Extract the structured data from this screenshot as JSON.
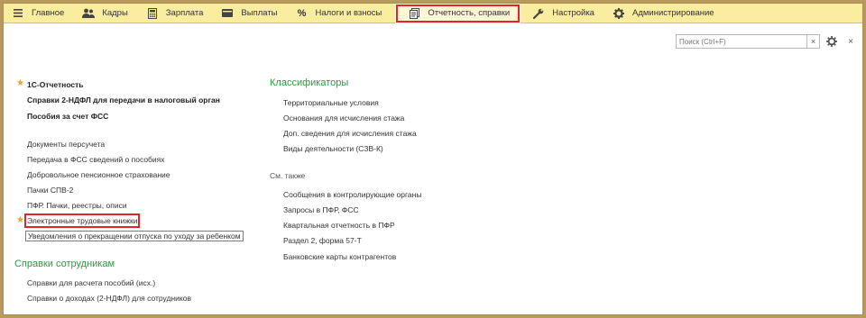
{
  "nav": {
    "items": [
      {
        "label": "Главное",
        "icon": "menu-icon"
      },
      {
        "label": "Кадры",
        "icon": "people-icon"
      },
      {
        "label": "Зарплата",
        "icon": "calculator-icon"
      },
      {
        "label": "Выплаты",
        "icon": "wallet-icon"
      },
      {
        "label": "Налоги и взносы",
        "icon": "percent-icon"
      },
      {
        "label": "Отчетность, справки",
        "icon": "report-icon"
      },
      {
        "label": "Настройка",
        "icon": "wrench-icon"
      },
      {
        "label": "Администрирование",
        "icon": "gear-icon"
      }
    ],
    "active_index": 5
  },
  "search": {
    "placeholder": "Поиск (Ctrl+F)",
    "clear": "×"
  },
  "toolbar": {
    "close": "×"
  },
  "left": {
    "favorites": [
      "1С-Отчетность",
      "Справки 2-НДФЛ для передачи в налоговый орган",
      "Пособия за счет ФСС"
    ],
    "links": [
      "Документы персучета",
      "Передача в ФСС сведений о пособиях",
      "Добровольное пенсионное страхование",
      "Пачки СПВ-2",
      "ПФР. Пачки, реестры, описи",
      "Электронные трудовые книжки",
      "Уведомления о прекращении отпуска по уходу за ребенком"
    ],
    "employees_title": "Справки сотрудникам",
    "employees_links": [
      "Справки для расчета пособий (исх.)",
      "Справки о доходах (2-НДФЛ) для сотрудников"
    ]
  },
  "right": {
    "classifiers_title": "Классификаторы",
    "classifiers": [
      "Территориальные условия",
      "Основания для исчисления стажа",
      "Доп. сведения для исчисления стажа",
      "Виды деятельности (СЗВ-К)"
    ],
    "see_also_title": "См. также",
    "see_also": [
      "Сообщения в контролирующие органы",
      "Запросы в ПФР, ФСС",
      "Квартальная отчетность в ПФР",
      "Раздел 2, форма 57-Т",
      "Банковские карты контрагентов"
    ]
  },
  "colors": {
    "accent_green": "#2b9a3e",
    "highlight_red": "#e3242b",
    "topbar": "#fbeda0",
    "star": "#f0a030"
  }
}
